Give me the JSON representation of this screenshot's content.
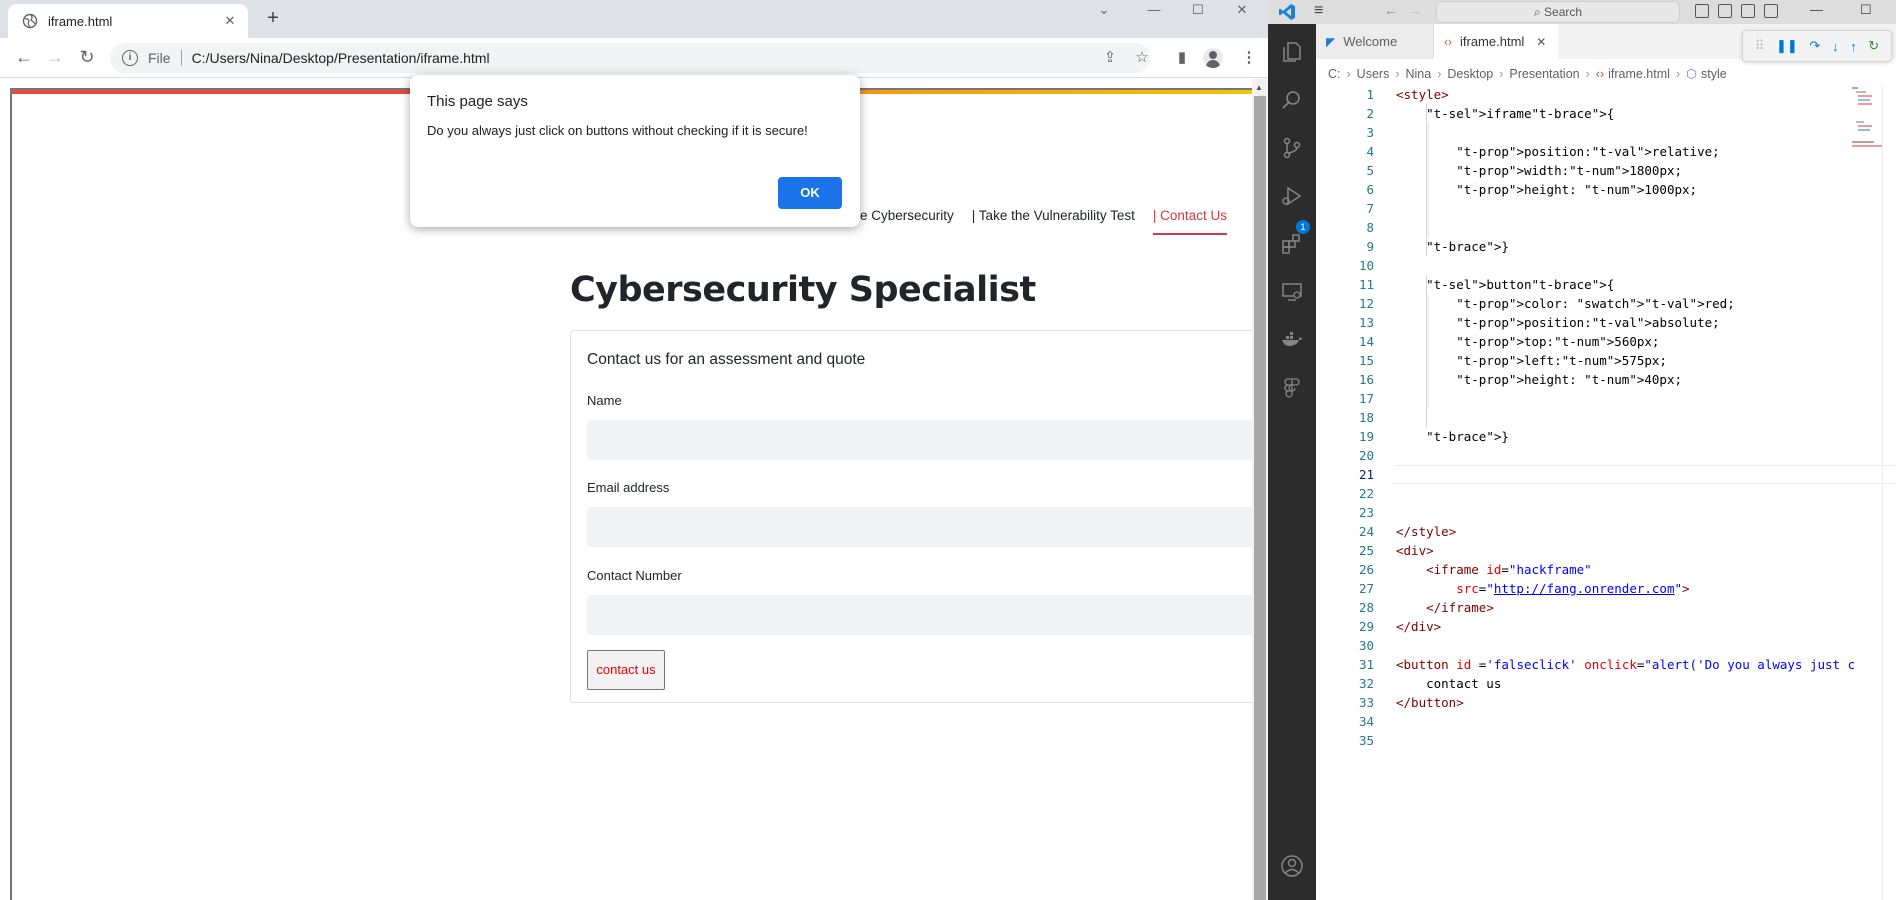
{
  "browser": {
    "tab_title": "iframe.html",
    "tab_close": "✕",
    "new_tab": "+",
    "address_prefix": "File",
    "address_url": "C:/Users/Nina/Desktop/Presentation/iframe.html"
  },
  "site": {
    "nav": [
      "e Cybersecurity",
      "| Take the Vulnerability Test",
      "| Contact Us"
    ],
    "title": "Cybersecurity Specialist",
    "card_heading": "Contact us for an assessment and quote",
    "fields": [
      "Name",
      "Email address",
      "Contact Number"
    ],
    "button_label": "contact us"
  },
  "alert": {
    "title": "This page says",
    "message": "Do you always just click on buttons without checking if it is secure!",
    "ok_label": "OK"
  },
  "vscode": {
    "search_placeholder": "Search",
    "tabs": [
      "Welcome",
      "iframe.html"
    ],
    "tab_close": "✕",
    "breadcrumb": [
      "C:",
      "Users",
      "Nina",
      "Desktop",
      "Presentation",
      "iframe.html",
      "style"
    ],
    "debug_badge": "1",
    "code": [
      "<style>",
      "    iframe{",
      "",
      "        position:relative;",
      "        width:1800px;",
      "        height: 1000px;",
      "",
      "",
      "    }",
      "",
      "    button{",
      "        color: red;",
      "        position:absolute;",
      "        top:560px;",
      "        left:575px;",
      "        height: 40px;",
      "",
      "",
      "    }",
      "",
      "",
      "",
      "",
      "</style>",
      "<div>",
      "    <iframe id=\"hackframe\"",
      "        src=\"http://fang.onrender.com\">",
      "    </iframe>",
      "</div>",
      "",
      "<button id ='falseclick' onclick=\"alert('Do you always just c",
      "    contact us",
      "</button>",
      "",
      ""
    ],
    "current_line": 21
  },
  "colors": {
    "alert_button": "#1a73e8",
    "active_nav": "#dc3545",
    "fake_button_text": "#ee0000",
    "vscode_accent": "#007acc"
  }
}
